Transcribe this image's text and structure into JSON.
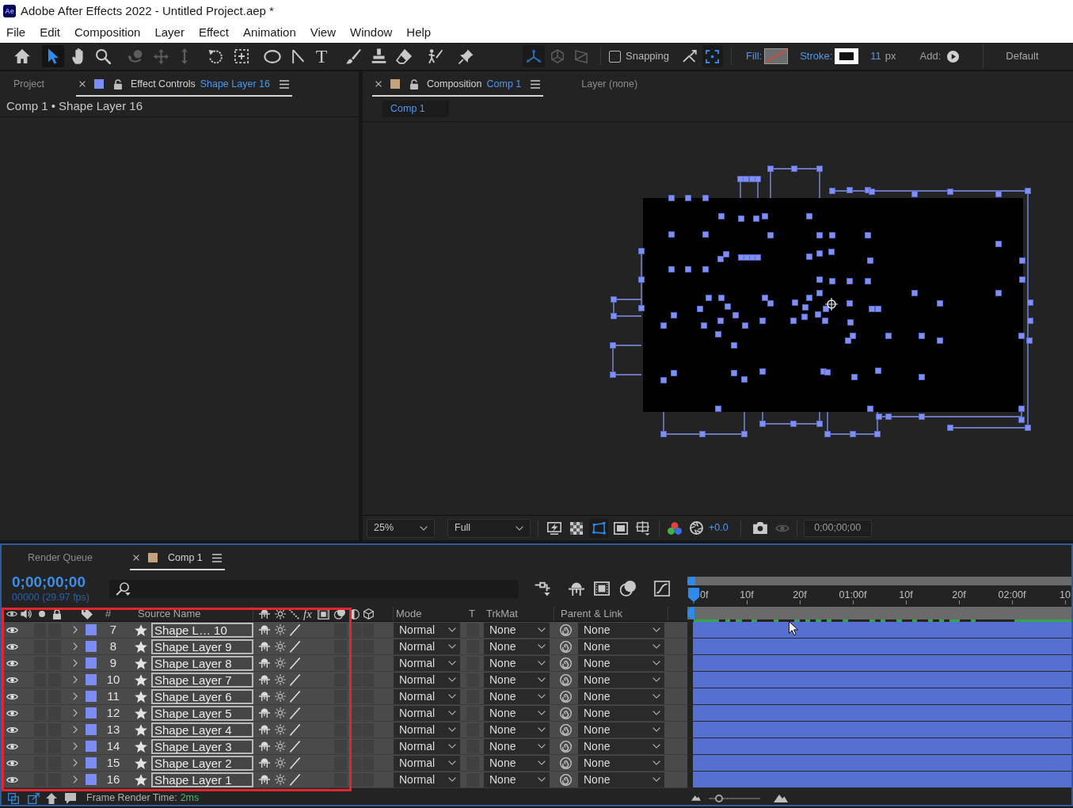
{
  "window": {
    "app_icon": "Ae",
    "title": "Adobe After Effects 2022 - Untitled Project.aep *"
  },
  "menu": [
    "File",
    "Edit",
    "Composition",
    "Layer",
    "Effect",
    "Animation",
    "View",
    "Window",
    "Help"
  ],
  "toolbar": {
    "tools": [
      {
        "kind": "home",
        "selected": false,
        "disabled": false
      },
      {
        "kind": "selection",
        "selected": true,
        "disabled": false
      },
      {
        "kind": "hand",
        "selected": false,
        "disabled": false
      },
      {
        "kind": "zoom",
        "selected": false,
        "disabled": false
      },
      {
        "kind": "orbit",
        "selected": false,
        "disabled": true
      },
      {
        "kind": "pan",
        "selected": false,
        "disabled": true
      },
      {
        "kind": "dolly",
        "selected": false,
        "disabled": true
      },
      {
        "kind": "rotation",
        "selected": false,
        "disabled": false
      },
      {
        "kind": "pan-behind",
        "selected": false,
        "disabled": false
      },
      {
        "kind": "ellipse",
        "selected": false,
        "disabled": false
      },
      {
        "kind": "pen",
        "selected": false,
        "disabled": false
      },
      {
        "kind": "type",
        "glyph": "T",
        "selected": false,
        "disabled": false
      },
      {
        "kind": "brush",
        "selected": false,
        "disabled": false
      },
      {
        "kind": "stamp",
        "selected": false,
        "disabled": false
      },
      {
        "kind": "eraser",
        "selected": false,
        "disabled": false
      },
      {
        "kind": "roto",
        "selected": false,
        "disabled": false
      },
      {
        "kind": "pin",
        "selected": false,
        "disabled": false
      }
    ],
    "axis_modes": [
      {
        "kind": "local",
        "selected": true,
        "disabled": true
      },
      {
        "kind": "world",
        "selected": false,
        "disabled": true
      },
      {
        "kind": "view",
        "selected": false,
        "disabled": true
      }
    ],
    "snapping": {
      "label": "Snapping",
      "checked": false
    },
    "snap_options": [
      {
        "kind": "edges",
        "selected": false
      },
      {
        "kind": "features",
        "selected": true
      }
    ],
    "fill": {
      "label": "Fill:",
      "none": true
    },
    "stroke": {
      "label": "Stroke:",
      "none": false
    },
    "stroke_width": {
      "value": "11",
      "unit": "px"
    },
    "add": {
      "label": "Add:"
    },
    "workspace": "Default"
  },
  "effect_panel": {
    "tabs": [
      {
        "label": "Project",
        "selected": false
      },
      {
        "label": "Effect Controls",
        "subject": "Shape Layer 16",
        "selected": true,
        "color": "#7b8df2",
        "locked": false
      }
    ],
    "breadcrumb": "Comp 1 • Shape Layer 16"
  },
  "composition_panel": {
    "tabs": [
      {
        "label": "Composition",
        "subject": "Comp 1",
        "selected": true,
        "color": "#c4a27c",
        "locked": false
      },
      {
        "label": "Layer (none)",
        "selected": false
      }
    ],
    "breadcrumbs": [
      {
        "label": "Comp 1",
        "selected": true
      }
    ],
    "footer": {
      "magnification": "25%",
      "resolution": "Full",
      "view_tools": [
        {
          "kind": "fast-previews",
          "selected": false
        },
        {
          "kind": "transparency-grid",
          "selected": false
        },
        {
          "kind": "mask-visibility",
          "selected": true
        },
        {
          "kind": "region-of-interest",
          "selected": false
        },
        {
          "kind": "grid-guides",
          "selected": false
        }
      ],
      "exposure": "+0.0",
      "timecode": "0;00;00;00"
    }
  },
  "timeline": {
    "tabs": [
      {
        "label": "Render Queue",
        "selected": false
      },
      {
        "label": "Comp 1",
        "selected": true,
        "color": "#c4a27c"
      }
    ],
    "timecode": "0;00;00;00",
    "frame_info": "00000 (29.97 fps)",
    "columns": {
      "number": "#",
      "source_name": "Source Name",
      "effects": "fx",
      "mode": "Mode",
      "preserve_transparency": "T",
      "track_matte": "TrkMat",
      "parent": "Parent & Link"
    },
    "layers": [
      {
        "number": "7",
        "name": "Shape L… 10",
        "color": "#7b8df2",
        "visible": true,
        "expanded": false,
        "mode": "Normal",
        "track_matte": "None",
        "parent": "None"
      },
      {
        "number": "8",
        "name": "Shape Layer 9",
        "color": "#7b8df2",
        "visible": true,
        "expanded": false,
        "mode": "Normal",
        "track_matte": "None",
        "parent": "None"
      },
      {
        "number": "9",
        "name": "Shape Layer 8",
        "color": "#7b8df2",
        "visible": true,
        "expanded": false,
        "mode": "Normal",
        "track_matte": "None",
        "parent": "None"
      },
      {
        "number": "10",
        "name": "Shape Layer 7",
        "color": "#7b8df2",
        "visible": true,
        "expanded": false,
        "mode": "Normal",
        "track_matte": "None",
        "parent": "None"
      },
      {
        "number": "11",
        "name": "Shape Layer 6",
        "color": "#7b8df2",
        "visible": true,
        "expanded": false,
        "mode": "Normal",
        "track_matte": "None",
        "parent": "None"
      },
      {
        "number": "12",
        "name": "Shape Layer 5",
        "color": "#7b8df2",
        "visible": true,
        "expanded": false,
        "mode": "Normal",
        "track_matte": "None",
        "parent": "None"
      },
      {
        "number": "13",
        "name": "Shape Layer 4",
        "color": "#7b8df2",
        "visible": true,
        "expanded": false,
        "mode": "Normal",
        "track_matte": "None",
        "parent": "None"
      },
      {
        "number": "14",
        "name": "Shape Layer 3",
        "color": "#7b8df2",
        "visible": true,
        "expanded": false,
        "mode": "Normal",
        "track_matte": "None",
        "parent": "None"
      },
      {
        "number": "15",
        "name": "Shape Layer 2",
        "color": "#7b8df2",
        "visible": true,
        "expanded": false,
        "mode": "Normal",
        "track_matte": "None",
        "parent": "None"
      },
      {
        "number": "16",
        "name": "Shape Layer 1",
        "color": "#7b8df2",
        "visible": true,
        "expanded": false,
        "mode": "Normal",
        "track_matte": "None",
        "parent": "None"
      }
    ],
    "ruler": [
      "0f",
      "10f",
      "20f",
      "01:00f",
      "10f",
      "20f",
      "02:00f",
      "10"
    ],
    "render_time": {
      "label": "Frame Render Time:",
      "value": "2ms"
    },
    "zoom_slider": {
      "level": 0.15
    }
  }
}
